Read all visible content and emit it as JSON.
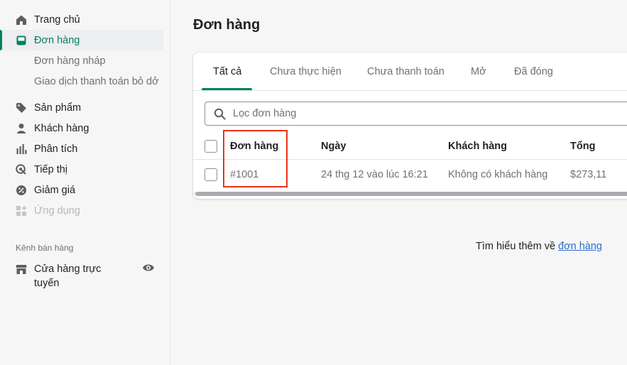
{
  "sidebar": {
    "items": [
      {
        "label": "Trang chủ",
        "icon": "home-icon"
      },
      {
        "label": "Đơn hàng",
        "icon": "orders-icon",
        "active": true
      },
      {
        "label": "Sản phẩm",
        "icon": "tag-icon"
      },
      {
        "label": "Khách hàng",
        "icon": "person-icon"
      },
      {
        "label": "Phân tích",
        "icon": "bar-chart-icon"
      },
      {
        "label": "Tiếp thị",
        "icon": "target-icon"
      },
      {
        "label": "Giảm giá",
        "icon": "discount-icon"
      },
      {
        "label": "Ứng dụng",
        "icon": "apps-icon",
        "disabled": true
      }
    ],
    "sub_items": [
      {
        "label": "Đơn hàng nháp"
      },
      {
        "label": "Giao dịch thanh toán bỏ dở"
      }
    ],
    "sales_channels_title": "Kênh bán hàng",
    "online_store": {
      "label": "Cửa hàng trực tuyến",
      "icon": "store-icon",
      "view_icon": "eye-icon"
    }
  },
  "main": {
    "title": "Đơn hàng",
    "tabs": [
      {
        "label": "Tất cả",
        "active": true
      },
      {
        "label": "Chưa thực hiện"
      },
      {
        "label": "Chưa thanh toán"
      },
      {
        "label": "Mở"
      },
      {
        "label": "Đã đóng"
      }
    ],
    "search": {
      "placeholder": "Lọc đơn hàng",
      "value": ""
    },
    "table": {
      "headers": [
        "Đơn hàng",
        "Ngày",
        "Khách hàng",
        "Tổng"
      ],
      "rows": [
        {
          "order": "#1001",
          "date": "24 thg 12 vào lúc 16:21",
          "customer": "Không có khách hàng",
          "total": "$273,11"
        }
      ]
    },
    "learn_more": {
      "text": "Tìm hiểu thêm về ",
      "link": "đơn hàng"
    }
  },
  "colors": {
    "accent": "#008060",
    "highlight": "#e8331a",
    "link": "#2c6ecb"
  }
}
